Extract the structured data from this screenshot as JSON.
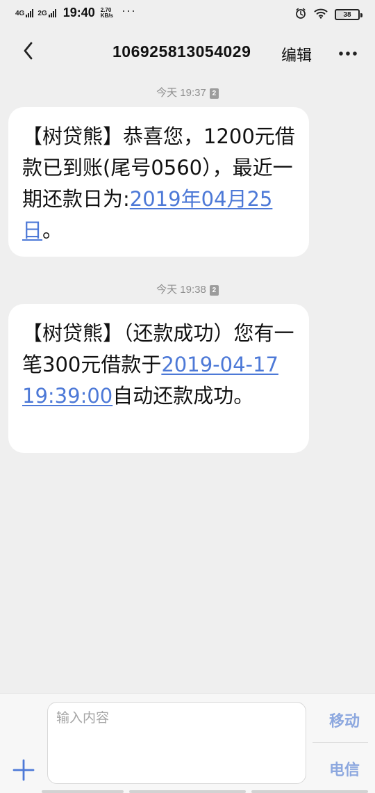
{
  "status_bar": {
    "network_1": "4G",
    "network_2": "2G",
    "time": "19:40",
    "speed_value": "2.70",
    "speed_unit": "KB/s",
    "more_indicator": "···",
    "battery_level": "38",
    "icons": [
      "signal-icon",
      "alarm-icon",
      "wifi-icon",
      "battery-icon"
    ]
  },
  "header": {
    "title": "106925813054029",
    "edit_label": "编辑",
    "back_icon": "chevron-left-icon",
    "more_icon": "more-horizontal-icon"
  },
  "messages": [
    {
      "timestamp": "今天 19:37",
      "sim_badge": "2",
      "text_before": "【树贷熊】恭喜您，1200元借款已到账(尾号0560），最近一期还款日为:",
      "link_text": "2019年04月25日",
      "text_after": "。"
    },
    {
      "timestamp": "今天 19:38",
      "sim_badge": "2",
      "text_before": "【树贷熊】（还款成功）您有一笔300元借款于",
      "link_text": "2019-04-17 19:39:00",
      "text_after": "自动还款成功。"
    }
  ],
  "composer": {
    "placeholder": "输入内容",
    "sim_1_label": "移动",
    "sim_2_label": "电信",
    "plus_icon": "plus-icon"
  },
  "colors": {
    "background": "#efefef",
    "bubble": "#ffffff",
    "link": "#4d79d7",
    "sim_button": "#8da8df",
    "timestamp": "#8e8e8e"
  }
}
